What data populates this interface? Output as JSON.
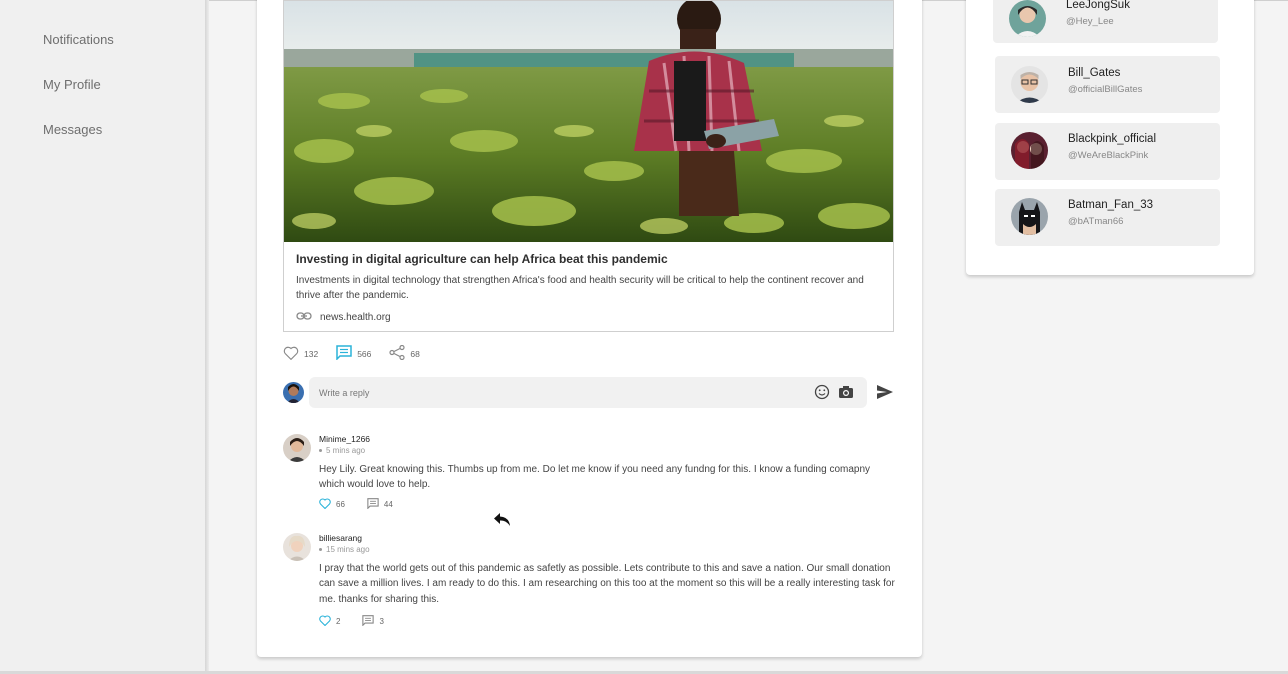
{
  "sidebar": {
    "items": [
      {
        "label": "Notifications"
      },
      {
        "label": "My Profile"
      },
      {
        "label": "Messages"
      }
    ]
  },
  "post": {
    "link_preview": {
      "image_icon": "farmer-photo",
      "title": "Investing in digital agriculture can help Africa beat this pandemic",
      "description": "Investments in digital technology that strengthen Africa's food and health security will be critical to help the continent recover and thrive after the pandemic.",
      "url_icon": "link-icon",
      "url": "news.health.org"
    },
    "actions": {
      "likes": "132",
      "comments": "566",
      "shares": "68"
    },
    "reply": {
      "placeholder": "Write a reply"
    },
    "comments": [
      {
        "username": "Minime_1266",
        "time": "5 mins ago",
        "text": "Hey Lily. Great knowing this. Thumbs up from me. Do let me know if you need any fundng for this. I know a funding comapny which would love to help.",
        "likes": "66",
        "replies": "44"
      },
      {
        "username": "billiesarang",
        "time": "15 mins ago",
        "text": "I pray that the world gets out of this pandemic as safetly as possible. Lets contribute to this and save a nation. Our small donation can save a million lives. I am ready to do this. I am researching on this too at the moment so this will be a really interesting task for me. thanks for sharing this.",
        "likes": "2",
        "replies": "3"
      }
    ]
  },
  "suggested_users": [
    {
      "name": "LeeJongSuk",
      "handle": "@Hey_Lee"
    },
    {
      "name": "Bill_Gates",
      "handle": "@officialBillGates"
    },
    {
      "name": "Blackpink_official",
      "handle": "@WeAreBlackPink"
    },
    {
      "name": "Batman_Fan_33",
      "handle": "@bATman66"
    }
  ],
  "colors": {
    "accent": "#2bb3d9",
    "icon_gray": "#777777"
  }
}
